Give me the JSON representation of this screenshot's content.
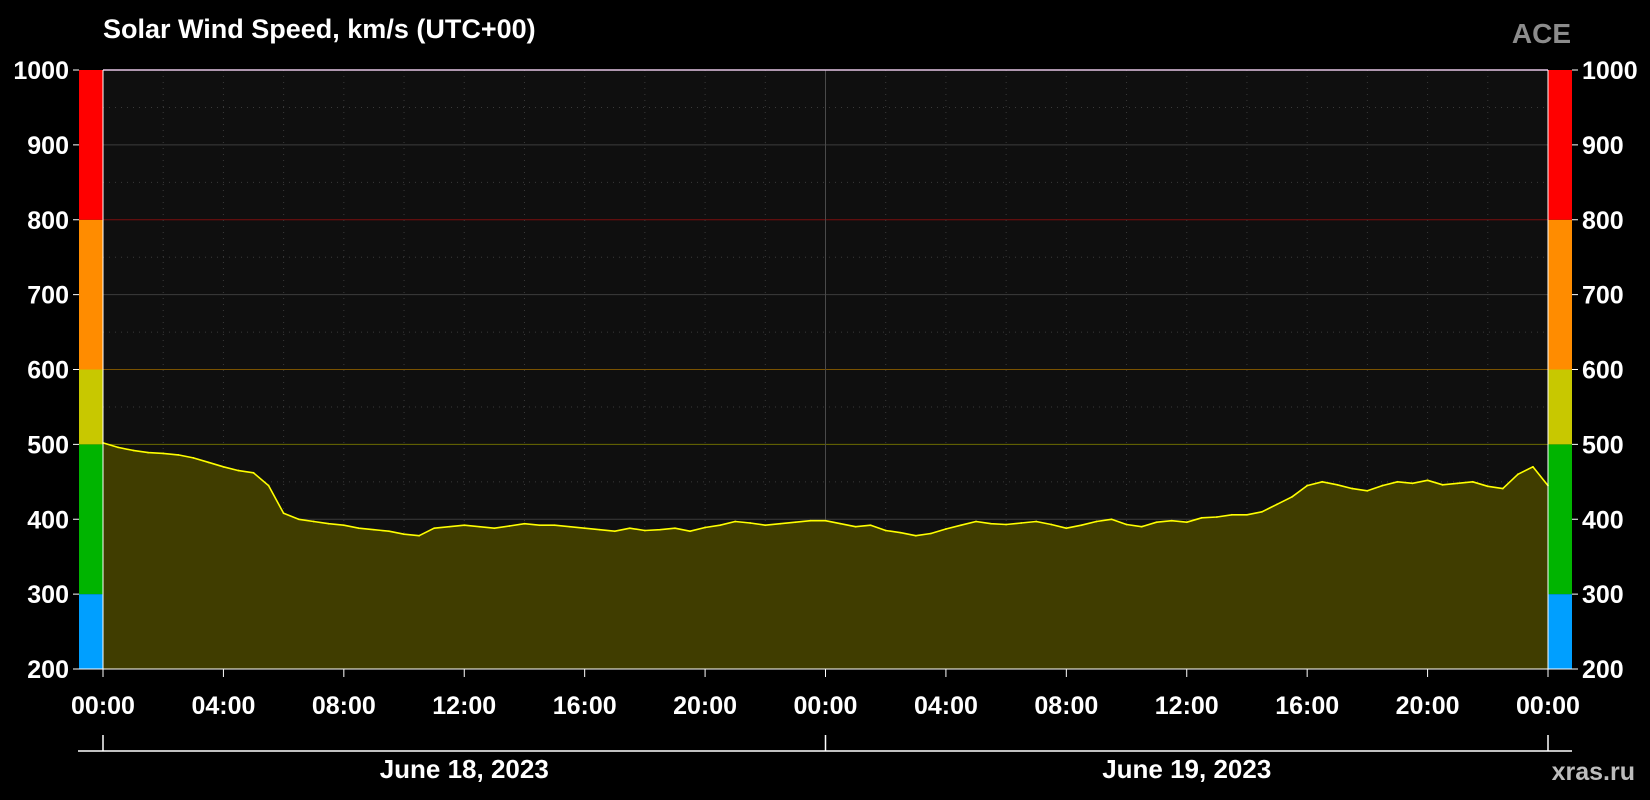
{
  "header": {
    "title": "Solar Wind Speed, km/s (UTC+00)",
    "source": "ACE"
  },
  "footer": {
    "credit": "xras.ru"
  },
  "colors": {
    "background": "#000000",
    "plot_background": "#0f0f0f",
    "line": "#ffff00",
    "fill": "#403d00",
    "band_blue": "#009fff",
    "band_green": "#00b400",
    "band_yellow": "#c8c800",
    "band_orange": "#ff8c00",
    "band_red": "#ff0000"
  },
  "chart_data": {
    "type": "line",
    "title": "Solar Wind Speed, km/s (UTC+00)",
    "xlabel": "",
    "ylabel": "",
    "ylim": [
      200,
      1000
    ],
    "xlim": [
      "2023-06-18T00:00",
      "2023-06-20T00:00"
    ],
    "yticks": [
      200,
      300,
      400,
      500,
      600,
      700,
      800,
      900,
      1000
    ],
    "xtick_labels": [
      "00:00",
      "04:00",
      "08:00",
      "12:00",
      "16:00",
      "20:00",
      "00:00",
      "04:00",
      "08:00",
      "12:00",
      "16:00",
      "20:00",
      "00:00"
    ],
    "date_labels": [
      "June 18, 2023",
      "June 19, 2023"
    ],
    "grid": true,
    "threshold_lines": [
      500,
      600,
      800
    ],
    "color_bands": [
      {
        "from": 200,
        "to": 300,
        "color": "#009fff"
      },
      {
        "from": 300,
        "to": 500,
        "color": "#00b400"
      },
      {
        "from": 500,
        "to": 600,
        "color": "#c8c800"
      },
      {
        "from": 600,
        "to": 800,
        "color": "#ff8c00"
      },
      {
        "from": 800,
        "to": 1000,
        "color": "#ff0000"
      }
    ],
    "series": [
      {
        "x": [
          "2023-06-18T00:00",
          "2023-06-18T00:30",
          "2023-06-18T01:00",
          "2023-06-18T01:30",
          "2023-06-18T02:00",
          "2023-06-18T02:30",
          "2023-06-18T03:00",
          "2023-06-18T03:30",
          "2023-06-18T04:00",
          "2023-06-18T04:30",
          "2023-06-18T05:00",
          "2023-06-18T05:30",
          "2023-06-18T06:00",
          "2023-06-18T06:30",
          "2023-06-18T07:00",
          "2023-06-18T07:30",
          "2023-06-18T08:00",
          "2023-06-18T08:30",
          "2023-06-18T09:00",
          "2023-06-18T09:30",
          "2023-06-18T10:00",
          "2023-06-18T10:30",
          "2023-06-18T11:00",
          "2023-06-18T11:30",
          "2023-06-18T12:00",
          "2023-06-18T12:30",
          "2023-06-18T13:00",
          "2023-06-18T13:30",
          "2023-06-18T14:00",
          "2023-06-18T14:30",
          "2023-06-18T15:00",
          "2023-06-18T15:30",
          "2023-06-18T16:00",
          "2023-06-18T16:30",
          "2023-06-18T17:00",
          "2023-06-18T17:30",
          "2023-06-18T18:00",
          "2023-06-18T18:30",
          "2023-06-18T19:00",
          "2023-06-18T19:30",
          "2023-06-18T20:00",
          "2023-06-18T20:30",
          "2023-06-18T21:00",
          "2023-06-18T21:30",
          "2023-06-18T22:00",
          "2023-06-18T22:30",
          "2023-06-18T23:00",
          "2023-06-18T23:30",
          "2023-06-19T00:00",
          "2023-06-19T00:30",
          "2023-06-19T01:00",
          "2023-06-19T01:30",
          "2023-06-19T02:00",
          "2023-06-19T02:30",
          "2023-06-19T03:00",
          "2023-06-19T03:30",
          "2023-06-19T04:00",
          "2023-06-19T04:30",
          "2023-06-19T05:00",
          "2023-06-19T05:30",
          "2023-06-19T06:00",
          "2023-06-19T06:30",
          "2023-06-19T07:00",
          "2023-06-19T07:30",
          "2023-06-19T08:00",
          "2023-06-19T08:30",
          "2023-06-19T09:00",
          "2023-06-19T09:30",
          "2023-06-19T10:00",
          "2023-06-19T10:30",
          "2023-06-19T11:00",
          "2023-06-19T11:30",
          "2023-06-19T12:00",
          "2023-06-19T12:30",
          "2023-06-19T13:00",
          "2023-06-19T13:30",
          "2023-06-19T14:00",
          "2023-06-19T14:30",
          "2023-06-19T15:00",
          "2023-06-19T15:30",
          "2023-06-19T16:00",
          "2023-06-19T16:30",
          "2023-06-19T17:00",
          "2023-06-19T17:30",
          "2023-06-19T18:00",
          "2023-06-19T18:30",
          "2023-06-19T19:00",
          "2023-06-19T19:30",
          "2023-06-19T20:00",
          "2023-06-19T20:30",
          "2023-06-19T21:00",
          "2023-06-19T21:30",
          "2023-06-19T22:00",
          "2023-06-19T22:30",
          "2023-06-19T23:00",
          "2023-06-19T23:30",
          "2023-06-20T00:00"
        ],
        "values": [
          502,
          496,
          492,
          489,
          488,
          486,
          482,
          476,
          470,
          465,
          462,
          445,
          408,
          400,
          397,
          394,
          392,
          388,
          386,
          384,
          380,
          378,
          388,
          390,
          392,
          390,
          388,
          391,
          394,
          392,
          392,
          390,
          388,
          386,
          384,
          388,
          385,
          386,
          388,
          384,
          389,
          392,
          397,
          395,
          392,
          394,
          396,
          398,
          398,
          394,
          390,
          392,
          385,
          382,
          378,
          381,
          387,
          392,
          397,
          394,
          393,
          395,
          397,
          393,
          388,
          392,
          397,
          400,
          393,
          390,
          396,
          398,
          396,
          402,
          403,
          406,
          406,
          410,
          420,
          430,
          445,
          450,
          446,
          441,
          438,
          445,
          450,
          448,
          452,
          446,
          448,
          450,
          444,
          441,
          460,
          470,
          445
        ]
      }
    ]
  }
}
